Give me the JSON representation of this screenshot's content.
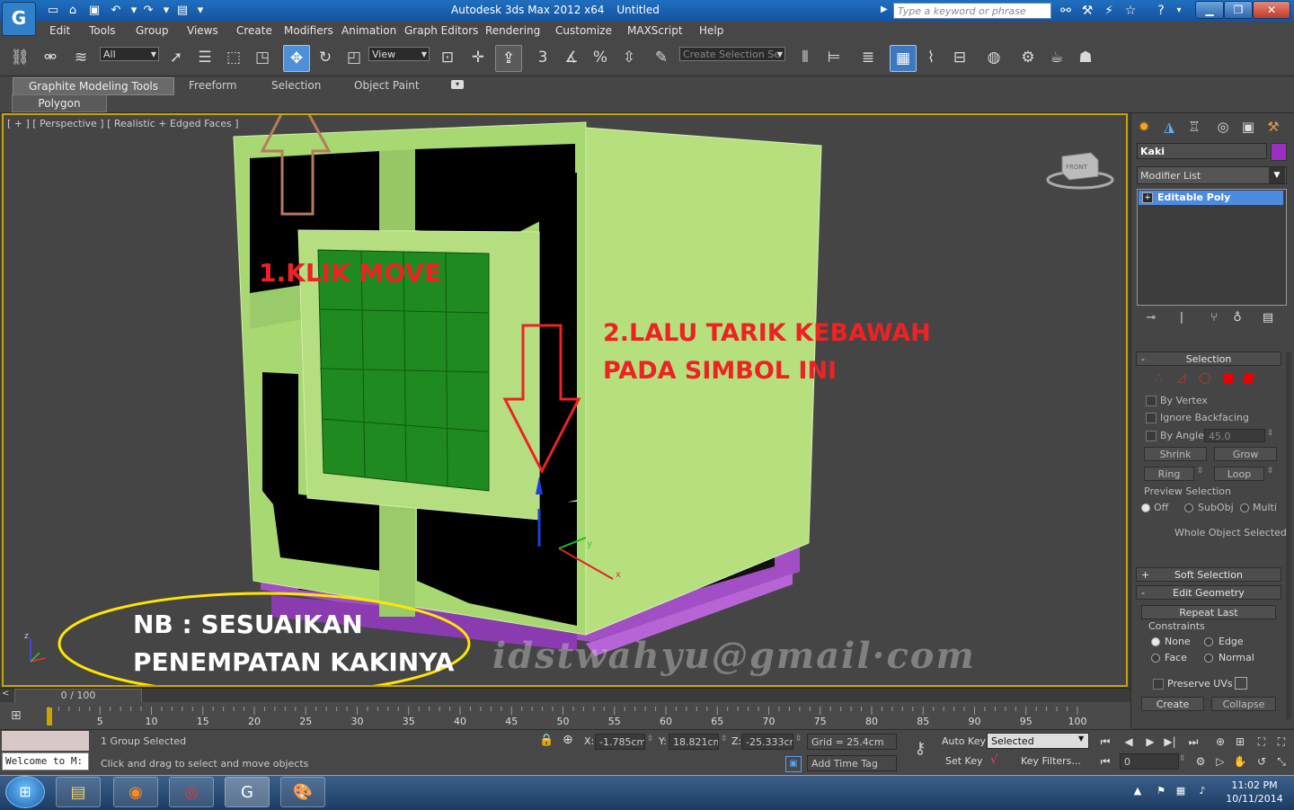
{
  "window": {
    "app_title": "Autodesk 3ds Max  2012 x64",
    "doc_title": "Untitled",
    "search_placeholder": "Type a keyword or phrase",
    "app_icon": "3ds-max-logo-icon"
  },
  "menu": [
    "Edit",
    "Tools",
    "Group",
    "Views",
    "Create",
    "Modifiers",
    "Animation",
    "Graph Editors",
    "Rendering",
    "Customize",
    "MAXScript",
    "Help"
  ],
  "toolbar": {
    "filter_value": "All",
    "coord_value": "View",
    "selection_set_placeholder": "Create Selection Se",
    "active_tool": "move-icon"
  },
  "ribbon": {
    "tabs": [
      "Graphite Modeling Tools",
      "Freeform",
      "Selection",
      "Object Paint"
    ],
    "subpanel": "Polygon Modeling"
  },
  "viewport": {
    "label": "[ + ] [ Perspective ] [ Realistic + Edged Faces ]",
    "viewcube_label": "FRONT",
    "axis": {
      "x": "x",
      "y": "y",
      "z": "z"
    }
  },
  "annotations": {
    "step1": "1.KLIK MOVE",
    "step2_line1": "2.LALU TARIK KEBAWAH",
    "step2_line2": "PADA SIMBOL INI",
    "note_line1": "NB : SESUAIKAN",
    "note_line2": "PENEMPATAN KAKINYA",
    "watermark": "idstwahyu@gmail·com",
    "colors": {
      "red": "#ee2222",
      "yellow": "#ffe600",
      "brown": "#b87a5a"
    }
  },
  "command_panel": {
    "object_name": "Kaki",
    "object_color": "#9b2fc4",
    "modifier_list": "Modifier List",
    "stack_item": "Editable Poly",
    "selection": {
      "title": "Selection",
      "by_vertex": "By Vertex",
      "ignore_backfacing": "Ignore Backfacing",
      "by_angle": "By Angle:",
      "angle_value": "45.0",
      "shrink": "Shrink",
      "grow": "Grow",
      "ring": "Ring",
      "loop": "Loop",
      "preview_title": "Preview Selection",
      "preview_off": "Off",
      "preview_subobj": "SubObj",
      "preview_multi": "Multi",
      "whole_object": "Whole Object Selected"
    },
    "soft_selection": "Soft Selection",
    "edit_geometry": {
      "title": "Edit Geometry",
      "repeat_last": "Repeat Last",
      "constraints": "Constraints",
      "none": "None",
      "edge": "Edge",
      "face": "Face",
      "normal": "Normal",
      "preserve_uvs": "Preserve UVs",
      "create": "Create",
      "collapse": "Collapse"
    }
  },
  "timeline": {
    "frame_readout": "0 / 100",
    "ticks": [
      "5",
      "10",
      "15",
      "20",
      "25",
      "30",
      "35",
      "40",
      "45",
      "50",
      "55",
      "60",
      "65",
      "70",
      "75",
      "80",
      "85",
      "90",
      "95",
      "100"
    ]
  },
  "status": {
    "script_listener": "Welcome to M:",
    "selection_status": "1 Group Selected",
    "prompt": "Click and drag to select and move objects",
    "x_label": "X:",
    "x_value": "-1.785cm",
    "y_label": "Y:",
    "y_value": "18.821cm",
    "z_label": "Z:",
    "z_value": "-25.333cm",
    "grid": "Grid = 25.4cm",
    "add_time_tag": "Add Time Tag",
    "auto_key": "Auto Key",
    "set_key": "Set Key",
    "key_mode_value": "Selected",
    "key_filters": "Key Filters...",
    "current_frame": "0"
  },
  "taskbar": {
    "time": "11:02 PM",
    "date": "10/11/2014"
  }
}
